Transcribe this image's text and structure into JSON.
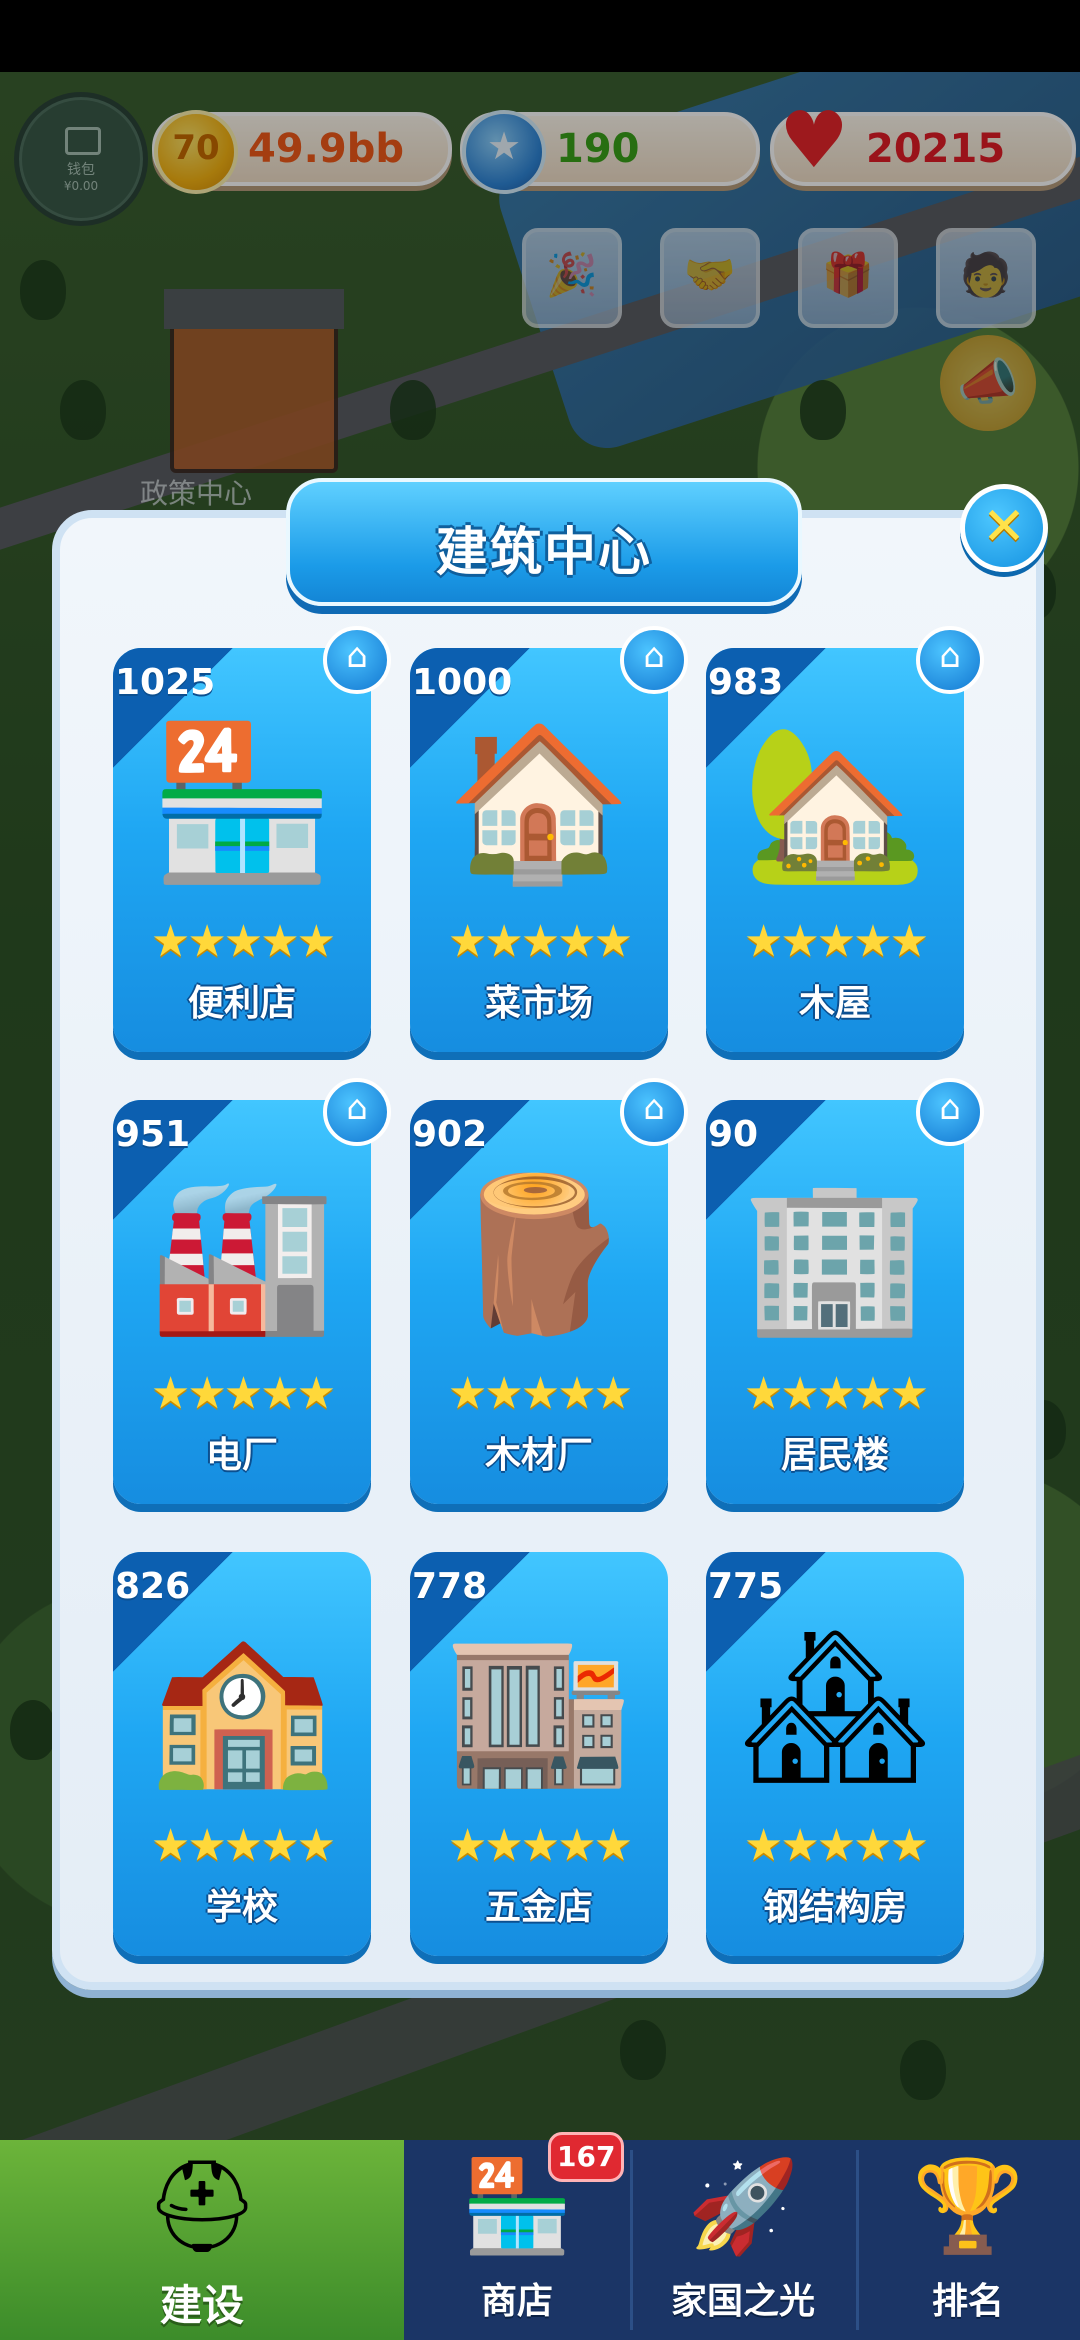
{
  "hud": {
    "wallet_label": "钱包",
    "wallet_amount": "¥0.00",
    "coins": "49.9bb",
    "gems": "190",
    "hearts": "20215",
    "coin_symbol": "70",
    "gem_symbol": "★",
    "heart_symbol": "♥",
    "coin_color": "#f25a1a",
    "gem_color": "#3aa21a",
    "heart_color": "#e31c27"
  },
  "activities": [
    {
      "icon": "🎉"
    },
    {
      "icon": "🤝"
    },
    {
      "icon": "🎁"
    },
    {
      "icon": "🧑"
    }
  ],
  "speaker_icon": "📣",
  "background_label": "政策中心",
  "dialog": {
    "title": "建筑中心",
    "close_symbol": "✕",
    "buildings": [
      {
        "name": "便利店",
        "score": "1025",
        "stars": 5,
        "icon": "🏪",
        "home": true
      },
      {
        "name": "菜市场",
        "score": "1000",
        "stars": 5,
        "icon": "🏠",
        "home": true
      },
      {
        "name": "木屋",
        "score": "983",
        "stars": 5,
        "icon": "🏡",
        "home": true
      },
      {
        "name": "电厂",
        "score": "951",
        "stars": 5,
        "icon": "🏭",
        "home": true
      },
      {
        "name": "木材厂",
        "score": "902",
        "stars": 5,
        "icon": "🪵",
        "home": true
      },
      {
        "name": "居民楼",
        "score": "90",
        "stars": 5,
        "icon": "🏢",
        "home": true
      },
      {
        "name": "学校",
        "score": "826",
        "stars": 5,
        "icon": "🏫",
        "home": false
      },
      {
        "name": "五金店",
        "score": "778",
        "stars": 5,
        "icon": "🏬",
        "home": false
      },
      {
        "name": "钢结构房",
        "score": "775",
        "stars": 5,
        "icon": "🏘",
        "home": false
      }
    ],
    "star_glyph": "★★★★★",
    "home_glyph": "⌂"
  },
  "nav": {
    "items": [
      {
        "label": "建设",
        "icon": "⛑",
        "active": true
      },
      {
        "label": "商店",
        "icon": "🏪",
        "active": false
      },
      {
        "label": "家国之光",
        "icon": "🚀",
        "active": false
      },
      {
        "label": "排名",
        "icon": "🏆",
        "active": false
      }
    ],
    "shop_badge": "167"
  }
}
